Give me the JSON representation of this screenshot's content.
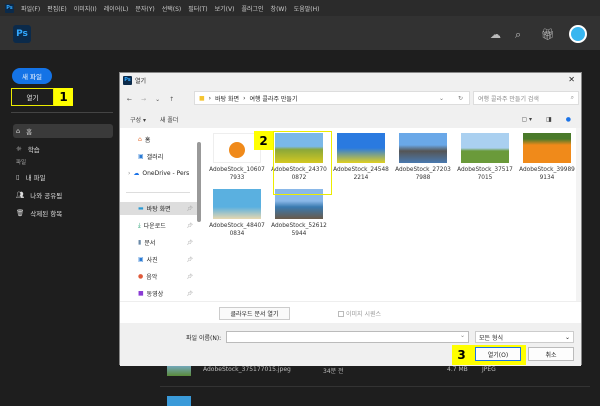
{
  "menubar": {
    "items": [
      "파일(F)",
      "편집(E)",
      "이미지(I)",
      "레이어(L)",
      "문자(Y)",
      "선택(S)",
      "필터(T)",
      "보기(V)",
      "플러그인",
      "창(W)",
      "도움말(H)"
    ]
  },
  "app": {
    "logo": "Ps"
  },
  "sidebar": {
    "new_file": "새 파일",
    "open": "열기",
    "section_label": "파일",
    "items": [
      {
        "label": "홈",
        "icon": "home-icon"
      },
      {
        "label": "학습",
        "icon": "lightbulb-icon"
      },
      {
        "label": "내 파일",
        "icon": "file-icon"
      },
      {
        "label": "나와 공유됨",
        "icon": "shared-icon"
      },
      {
        "label": "삭제된 항목",
        "icon": "trash-icon"
      }
    ]
  },
  "annotations": [
    "1",
    "2",
    "3"
  ],
  "dialog": {
    "title": "열기",
    "breadcrumb": [
      "바탕 화면",
      "여행 콜라주 만들기"
    ],
    "search_placeholder": "여행 콜라주 만들기 검색",
    "toolbar": {
      "organize": "구성 ▾",
      "new_folder": "새 폴더"
    },
    "nav": [
      {
        "label": "홈",
        "pin": false
      },
      {
        "label": "갤러리",
        "pin": false
      },
      {
        "label": "OneDrive - Pers",
        "pin": false
      },
      {
        "label": "바탕 화면",
        "pin": true
      },
      {
        "label": "다운로드",
        "pin": true
      },
      {
        "label": "문서",
        "pin": true
      },
      {
        "label": "사진",
        "pin": true
      },
      {
        "label": "음악",
        "pin": true
      },
      {
        "label": "동영상",
        "pin": true
      }
    ],
    "files": [
      "AdobeStock_106077933",
      "AdobeStock_243700872",
      "AdobeStock_245482214",
      "AdobeStock_272037988",
      "AdobeStock_375177015",
      "AdobeStock_399899134",
      "AdobeStock_484070834",
      "AdobeStock_526125944"
    ],
    "cloud_button": "클라우드 문서 열기",
    "image_sequence": "이미지 시퀀스",
    "filename_label": "파일 이름(N):",
    "filename_value": "",
    "filetype": "모든 형식",
    "open_button": "열기(O)",
    "cancel_button": "취소"
  },
  "background_row": {
    "name": "AdobeStock_375177015.jpeg",
    "time": "34분 전",
    "size": "4.7 MB",
    "type": "JPEG"
  },
  "colors": {
    "accent": "#1473e6",
    "highlight": "#ffff00"
  }
}
